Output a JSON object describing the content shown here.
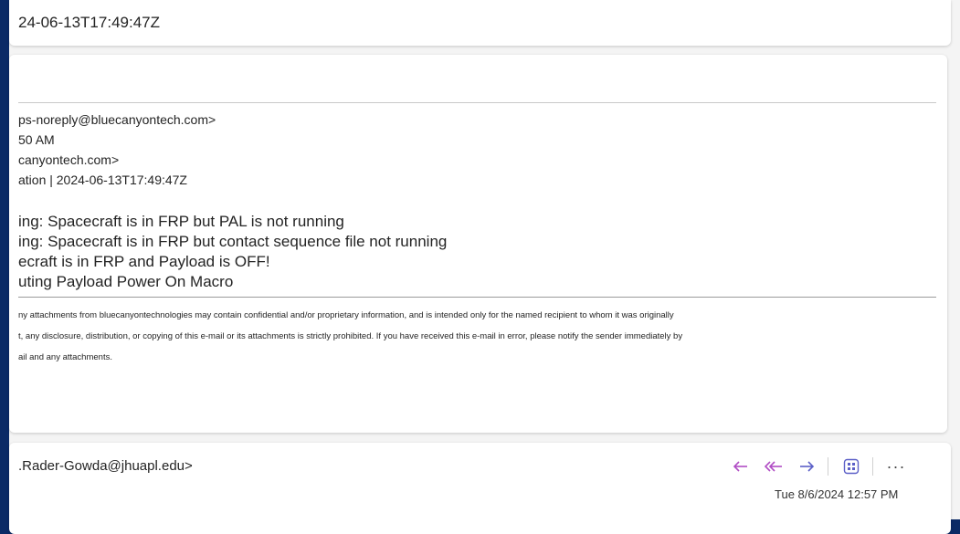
{
  "subject": "24-06-13T17:49:47Z",
  "message": {
    "header_lines": [
      "ps-noreply@bluecanyontech.com>",
      "50 AM",
      "canyontech.com>",
      "ation | 2024-06-13T17:49:47Z"
    ],
    "body_lines": [
      "ing: Spacecraft is in FRP but PAL is not running",
      "ing: Spacecraft is in FRP but contact sequence file not running",
      "ecraft is in FRP and Payload is OFF!",
      "uting Payload Power On Macro"
    ],
    "disclaimer_lines": [
      "ny attachments from bluecanyontechnologies may contain confidential and/or proprietary information, and is intended only for the named recipient to whom it was originally",
      "t, any disclosure, distribution, or copying of this e-mail or its attachments is strictly prohibited. If you have received this e-mail in error, please notify the sender immediately by",
      "ail and any attachments."
    ]
  },
  "reply": {
    "sender": ".Rader-Gowda@jhuapl.edu>",
    "timestamp": "Tue 8/6/2024 12:57 PM",
    "more_label": "···"
  },
  "icons": {
    "reply": "reply-icon",
    "reply_all": "reply-all-icon",
    "forward": "forward-icon",
    "apps": "apps-icon"
  },
  "colors": {
    "frame": "#0b2a66",
    "accent": "#5b5fc7",
    "reply_icon": "#b04cc4"
  }
}
